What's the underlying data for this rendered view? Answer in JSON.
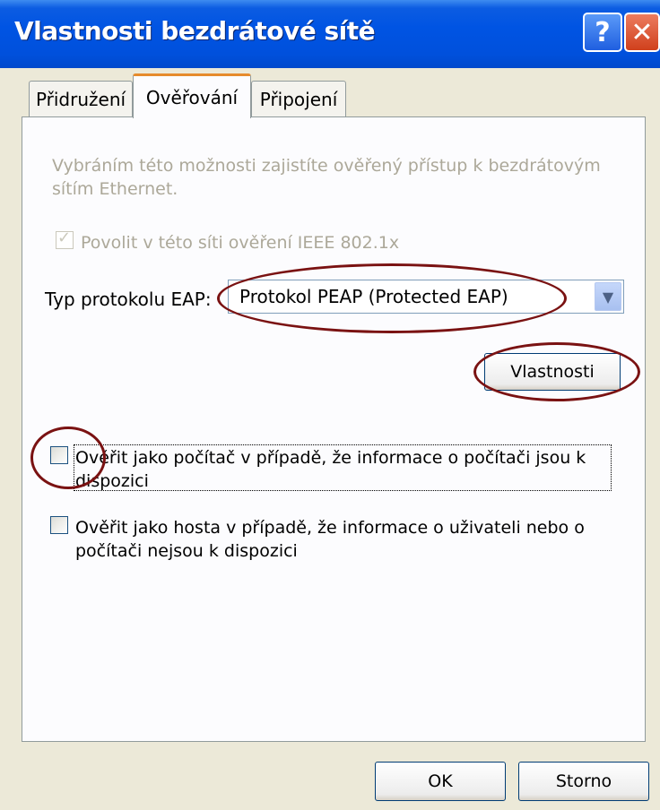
{
  "window": {
    "title": "Vlastnosti bezdrátové sítě"
  },
  "title_buttons": {
    "help": "?",
    "close": "✕"
  },
  "tabs": [
    {
      "label": "Přidružení"
    },
    {
      "label": "Ověřování"
    },
    {
      "label": "Připojení"
    }
  ],
  "auth": {
    "description": "Vybráním této možnosti zajistíte ověřený přístup k bezdrátovým sítím Ethernet.",
    "enable_8021x": {
      "label": "Povolit v této síti ověření IEEE 802.1x",
      "checked": true,
      "enabled": false
    },
    "eap_type_label": "Typ protokolu EAP:",
    "eap_type_value": "Protokol PEAP (Protected EAP)",
    "properties_button": "Vlastnosti",
    "auth_as_computer": {
      "label": "Ověřit jako počítač v případě, že informace o počítači jsou k dispozici",
      "checked": false
    },
    "auth_as_guest": {
      "label": "Ověřit jako hosta v případě, že informace o uživateli nebo o počítači nejsou k dispozici",
      "checked": false
    }
  },
  "footer": {
    "ok": "OK",
    "cancel": "Storno"
  },
  "colors": {
    "annotation": "#7a1212",
    "title_bar": "#0054e3",
    "active_tab_accent": "#e68b2c"
  }
}
